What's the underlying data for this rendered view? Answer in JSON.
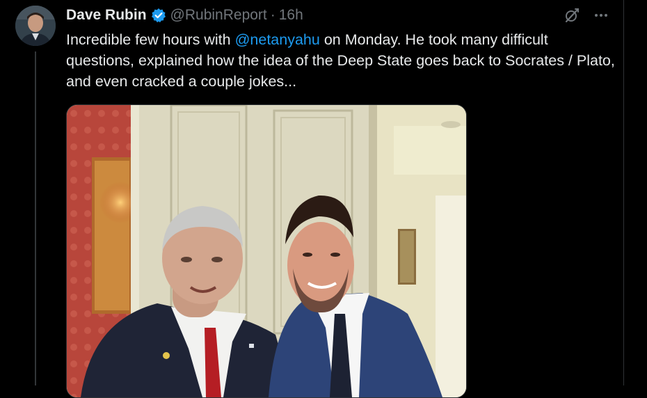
{
  "tweet": {
    "author_name": "Dave Rubin",
    "handle": "@RubinReport",
    "separator": "·",
    "time": "16h",
    "text_before": "Incredible few hours with ",
    "mention": "@netanyahu",
    "text_after": " on Monday. He took many difficult questions, explained how the idea of the Deep State goes back to Socrates / Plato, and even cracked a couple jokes..."
  },
  "icons": {
    "verified": "verified-badge-icon",
    "grok": "grok-icon",
    "more": "more-icon"
  },
  "colors": {
    "background": "#000000",
    "text": "#e7e9ea",
    "secondary": "#71767b",
    "link": "#1d9bf0",
    "verified": "#1d9bf0",
    "border": "#2f3336"
  }
}
